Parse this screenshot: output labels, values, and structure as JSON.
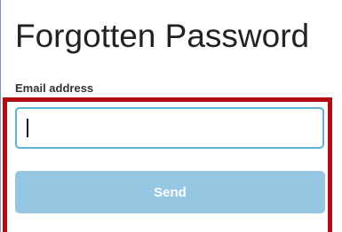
{
  "page": {
    "title": "Forgotten Password"
  },
  "form": {
    "email_label": "Email address",
    "email_value": "",
    "send_label": "Send"
  },
  "colors": {
    "highlight_border": "#b30d14",
    "input_focus_border": "#5ab3d6",
    "button_background": "#95c7e3",
    "button_text": "#ffffff"
  }
}
